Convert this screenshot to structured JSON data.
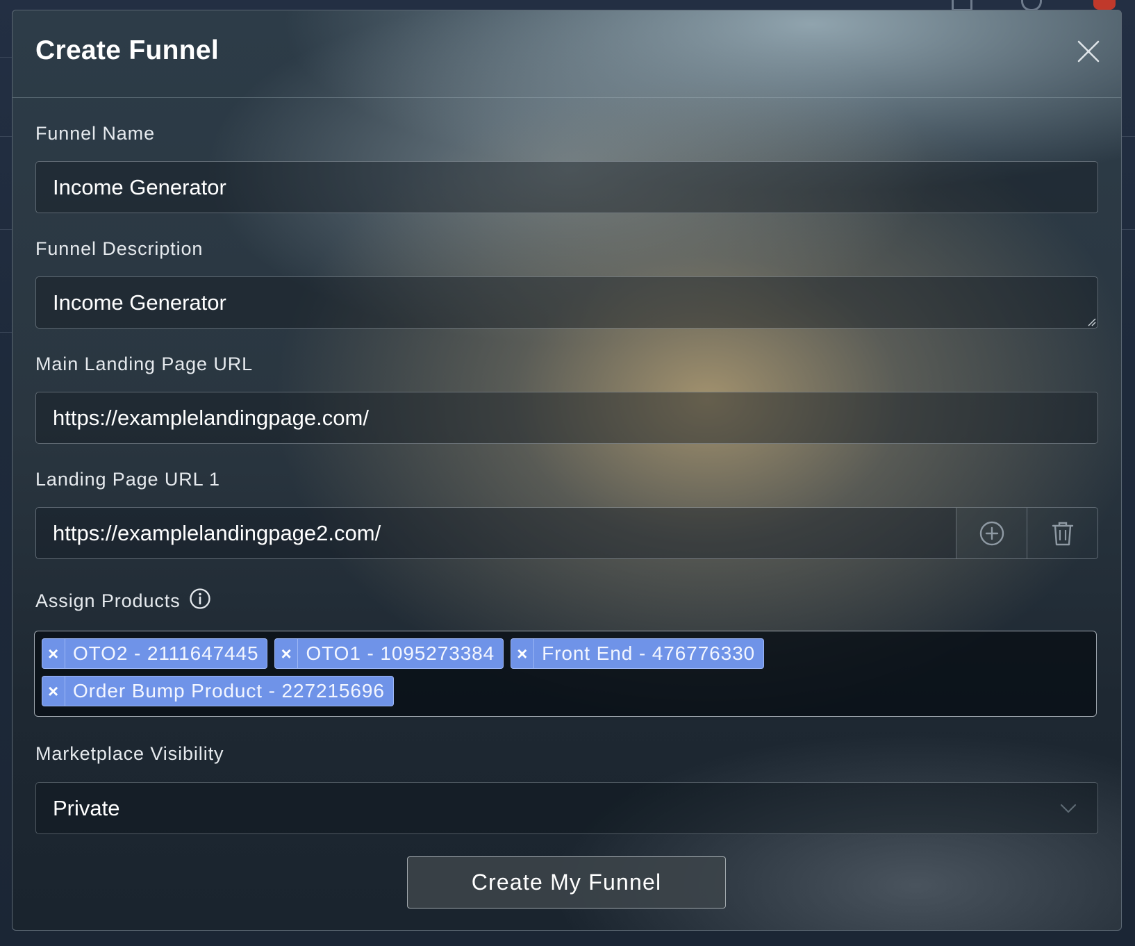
{
  "modal": {
    "title": "Create Funnel",
    "close_icon": "close-icon"
  },
  "funnel_name": {
    "label": "Funnel Name",
    "value": "Income Generator"
  },
  "funnel_description": {
    "label": "Funnel Description",
    "value": "Income Generator"
  },
  "main_landing_url": {
    "label": "Main Landing Page URL",
    "value": "https://examplelandingpage.com/"
  },
  "landing_url_1": {
    "label": "Landing Page URL 1",
    "value": "https://examplelandingpage2.com/",
    "add_icon": "plus-circle-icon",
    "delete_icon": "trash-icon"
  },
  "assign_products": {
    "label": "Assign Products",
    "info_icon": "info-icon",
    "remove_symbol": "×",
    "tags": [
      {
        "label": "OTO2 - 2111647445"
      },
      {
        "label": "OTO1 - 1095273384"
      },
      {
        "label": "Front End - 476776330"
      },
      {
        "label": "Order Bump Product - 227215696"
      }
    ]
  },
  "marketplace_visibility": {
    "label": "Marketplace Visibility",
    "selected": "Private",
    "chevron_icon": "chevron-down-icon"
  },
  "submit": {
    "label": "Create My Funnel"
  },
  "colors": {
    "tag_background": "#6f93e8",
    "tag_border": "#9db7f5",
    "text": "#ffffff"
  }
}
